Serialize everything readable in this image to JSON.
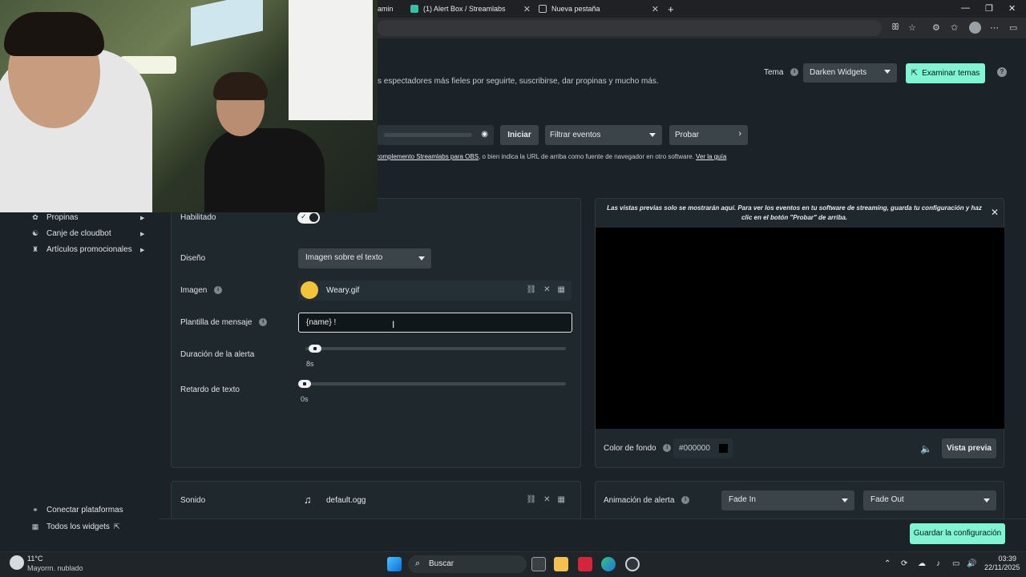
{
  "browser": {
    "tabs": [
      {
        "label": "amin"
      },
      {
        "label": "(1) Alert Box / Streamlabs"
      },
      {
        "label": "Nueva pestaña"
      }
    ],
    "new_tab": "+",
    "window_controls": {
      "minimize": "—",
      "maximize": "❐",
      "close": "✕"
    }
  },
  "header": {
    "description": "s espectadores más fieles por seguirte, suscribirse, dar propinas y mucho más.",
    "theme_label": "Tema",
    "theme_value": "Darken Widgets",
    "explore_themes": "Examinar temas",
    "help": "?"
  },
  "toolbar": {
    "start": "Iniciar",
    "filter_events": "Filtrar eventos",
    "test": "Probar",
    "guide_link1": "complemento Streamlabs para OBS",
    "guide_text": ", o bien indica la URL de arriba como fuente de navegador en otro software. ",
    "guide_link2": "Ver la guía"
  },
  "sidebar": {
    "items": [
      {
        "label": "Propinas",
        "icon": "tips-icon"
      },
      {
        "label": "Canje de cloudbot",
        "icon": "cloudbot-icon"
      },
      {
        "label": "Artículos promocionales",
        "icon": "shirt-icon"
      }
    ],
    "bottom": [
      {
        "label": "Conectar plataformas",
        "icon": "link-icon"
      },
      {
        "label": "Todos los widgets",
        "icon": "grid-icon"
      }
    ]
  },
  "settings": {
    "enabled_label": "Habilitado",
    "enabled": true,
    "design_label": "Diseño",
    "design_value": "Imagen sobre el texto",
    "image_label": "Imagen",
    "image_file": "Weary.gif",
    "template_label": "Plantilla de mensaje",
    "template_value": "{name} !",
    "duration_label": "Duración de la alerta",
    "duration_value": "8s",
    "duration_fraction": 0.02,
    "delay_label": "Retardo de texto",
    "delay_value": "0s",
    "delay_fraction": 0.0,
    "sound_label": "Sonido",
    "sound_file": "default.ogg"
  },
  "preview": {
    "note": "Las vistas previas solo se mostrarán aquí. Para ver los eventos en tu software de streaming, guarda tu configuración y haz clic en el botón \"Probar\" de arriba.",
    "bg_label": "Color de fondo",
    "bg_value": "#000000",
    "preview_button": "Vista previa",
    "animation_label": "Animación de alerta",
    "anim_in": "Fade In",
    "anim_out": "Fade Out"
  },
  "footer": {
    "save": "Guardar la configuración"
  },
  "taskbar": {
    "temp": "11°C",
    "weather": "Mayorm. nublado",
    "search": "Buscar",
    "time": "03:39",
    "date": "22/11/2025"
  },
  "colors": {
    "accent": "#80f5d2",
    "panel": "#1e282d",
    "background": "#1b2328"
  }
}
